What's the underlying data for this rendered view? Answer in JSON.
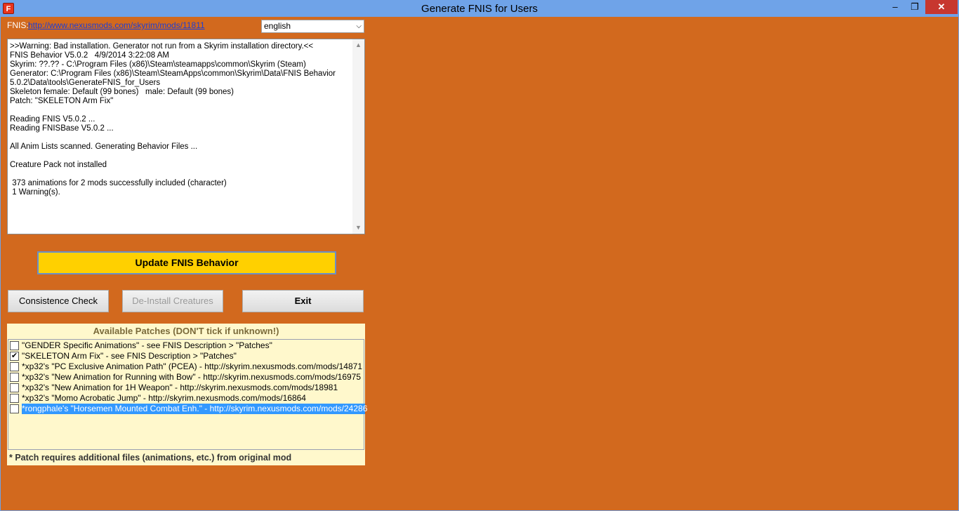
{
  "window": {
    "title": "Generate FNIS for Users",
    "icon_letter": "F",
    "minimize_glyph": "–",
    "restore_glyph": "❐",
    "close_glyph": "✕"
  },
  "header": {
    "fnis_label": "FNIS:",
    "fnis_link": "http://www.nexusmods.com/skyrim/mods/11811",
    "language_value": "english",
    "language_arrow": "⌵"
  },
  "log": {
    "text": ">>Warning: Bad installation. Generator not run from a Skyrim installation directory.<<\nFNIS Behavior V5.0.2   4/9/2014 3:22:08 AM\nSkyrim: ??.?? - C:\\Program Files (x86)\\Steam\\steamapps\\common\\Skyrim (Steam)\nGenerator: C:\\Program Files (x86)\\Steam\\SteamApps\\common\\Skyrim\\Data\\FNIS Behavior\n5.0.2\\Data\\tools\\GenerateFNIS_for_Users\nSkeleton female: Default (99 bones)   male: Default (99 bones)\nPatch: \"SKELETON Arm Fix\"\n\nReading FNIS V5.0.2 ...\nReading FNISBase V5.0.2 ...\n\nAll Anim Lists scanned. Generating Behavior Files ...\n\nCreature Pack not installed\n\n 373 animations for 2 mods successfully included (character)\n 1 Warning(s).",
    "scroll_up": "▲",
    "scroll_down": "▼"
  },
  "buttons": {
    "update": "Update FNIS Behavior",
    "consistence": "Consistence Check",
    "deinstall": "De-Install Creatures",
    "exit": "Exit"
  },
  "patches": {
    "heading": "Available Patches  (DON'T tick if unknown!)",
    "items": [
      {
        "label": "\"GENDER Specific Animations\" - see FNIS Description > \"Patches\"",
        "checked": false,
        "selected": false
      },
      {
        "label": "\"SKELETON Arm Fix\" - see FNIS Description > \"Patches\"",
        "checked": true,
        "selected": false
      },
      {
        "label": "*xp32's \"PC Exclusive Animation Path\" (PCEA) - http://skyrim.nexusmods.com/mods/14871",
        "checked": false,
        "selected": false
      },
      {
        "label": "*xp32's \"New Animation for Running with Bow\" - http://skyrim.nexusmods.com/mods/16975",
        "checked": false,
        "selected": false
      },
      {
        "label": "*xp32's \"New Animation for 1H Weapon\" - http://skyrim.nexusmods.com/mods/18981",
        "checked": false,
        "selected": false
      },
      {
        "label": "*xp32's \"Momo Acrobatic Jump\" - http://skyrim.nexusmods.com/mods/16864",
        "checked": false,
        "selected": false
      },
      {
        "label": "*rongphale's \"Horsemen Mounted Combat Enh.\" - http://skyrim.nexusmods.com/mods/24286",
        "checked": false,
        "selected": true
      }
    ],
    "check_glyph": "✔",
    "footnote": "* Patch requires additional files (animations, etc.) from original mod"
  },
  "colors": {
    "titlebar": "#6fa3e8",
    "client_bg": "#d2691e",
    "update_button": "#ffd000",
    "patch_panel": "#fff8cc",
    "selection": "#3399ff",
    "close_button": "#c7372f"
  }
}
